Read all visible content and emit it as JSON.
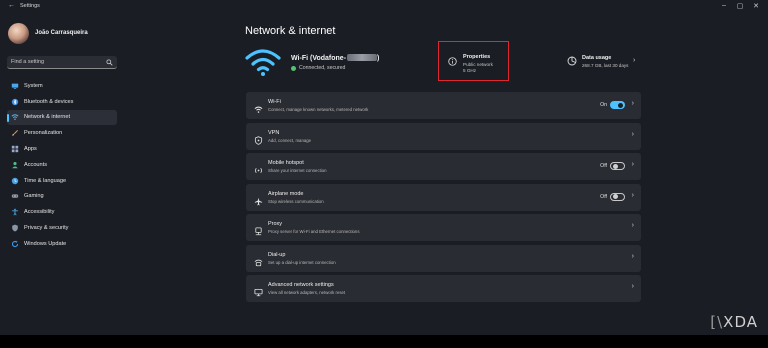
{
  "window": {
    "title": "Settings",
    "controls": [
      "–",
      "▢",
      "✕"
    ]
  },
  "user": {
    "name": "João Carrasqueira"
  },
  "search": {
    "placeholder": "Find a setting"
  },
  "sidebar": {
    "items": [
      {
        "label": "System",
        "icon": "monitor-icon",
        "color": "#4aa8e8",
        "active": false
      },
      {
        "label": "Bluetooth & devices",
        "icon": "bluetooth-icon",
        "color": "#3a8ee0",
        "active": false
      },
      {
        "label": "Network & internet",
        "icon": "wifi-icon",
        "color": "#5cb8f0",
        "active": true
      },
      {
        "label": "Personalization",
        "icon": "brush-icon",
        "color": "#e08a4a",
        "active": false
      },
      {
        "label": "Apps",
        "icon": "apps-icon",
        "color": "#9aa8c8",
        "active": false
      },
      {
        "label": "Accounts",
        "icon": "person-icon",
        "color": "#4ac08a",
        "active": false
      },
      {
        "label": "Time & language",
        "icon": "globe-clock-icon",
        "color": "#4aa0e0",
        "active": false
      },
      {
        "label": "Gaming",
        "icon": "controller-icon",
        "color": "#9a9aa8",
        "active": false
      },
      {
        "label": "Accessibility",
        "icon": "accessibility-icon",
        "color": "#4ab0f0",
        "active": false
      },
      {
        "label": "Privacy & security",
        "icon": "shield-icon",
        "color": "#8a96a8",
        "active": false
      },
      {
        "label": "Windows Update",
        "icon": "update-icon",
        "color": "#3aa0f0",
        "active": false
      }
    ]
  },
  "main": {
    "title": "Network & internet",
    "wifi": {
      "name": "Wi-Fi (Vodafone-",
      "name_suffix": ")",
      "status": "Connected, secured"
    },
    "properties": {
      "title": "Properties",
      "network_type": "Public network",
      "band": "5 GHz"
    },
    "data_usage": {
      "title": "Data usage",
      "value": "268.7 GB, last 30 days"
    },
    "rows": [
      {
        "title": "Wi-Fi",
        "subtitle": "Connect, manage known networks, metered network",
        "icon": "wifi-icon",
        "toggle": "on",
        "toggle_label": "On"
      },
      {
        "title": "VPN",
        "subtitle": "Add, connect, manage",
        "icon": "vpn-shield-icon",
        "toggle": null,
        "toggle_label": ""
      },
      {
        "title": "Mobile hotspot",
        "subtitle": "Share your internet connection",
        "icon": "hotspot-icon",
        "toggle": "off",
        "toggle_label": "Off"
      },
      {
        "title": "Airplane mode",
        "subtitle": "Stop wireless communication",
        "icon": "airplane-icon",
        "toggle": "off",
        "toggle_label": "Off"
      },
      {
        "title": "Proxy",
        "subtitle": "Proxy server for Wi-Fi and Ethernet connections",
        "icon": "proxy-icon",
        "toggle": null,
        "toggle_label": ""
      },
      {
        "title": "Dial-up",
        "subtitle": "Set up a dial-up internet connection",
        "icon": "dialup-icon",
        "toggle": null,
        "toggle_label": ""
      },
      {
        "title": "Advanced network settings",
        "subtitle": "View all network adapters, network reset",
        "icon": "advanced-network-icon",
        "toggle": null,
        "toggle_label": ""
      }
    ]
  },
  "accent_color": "#4cc2ff",
  "highlight_color": "#e0262f",
  "watermark": "XDA"
}
